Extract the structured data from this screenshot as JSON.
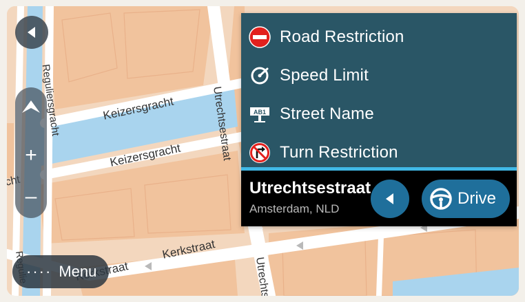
{
  "map": {
    "street_labels": {
      "keizersgracht_top": "Keizersgracht",
      "keizersgracht_bottom": "Keizersgracht",
      "utrechtsestraat_top": "Utrechtsestraat",
      "utrechtsestraat_bottom": "Utrechts",
      "reguliersgracht_top": "Reguliersgracht",
      "reguliersgracht_bottom": "Regulie",
      "kerkstraat_right": "Kerkstraat",
      "kerkstraat_left": "Kerkstraat",
      "partial_left": "cht"
    }
  },
  "context_menu": {
    "items": [
      {
        "label": "Road Restriction",
        "icon": "no-entry-icon"
      },
      {
        "label": "Speed Limit",
        "icon": "speedometer-icon"
      },
      {
        "label": "Street Name",
        "icon": "street-sign-icon"
      },
      {
        "label": "Turn Restriction",
        "icon": "no-right-turn-icon"
      }
    ]
  },
  "location": {
    "street": "Utrechtsestraat",
    "city": "Amsterdam, NLD"
  },
  "actions": {
    "drive_label": "Drive"
  },
  "controls": {
    "zoom_in": "+",
    "zoom_out": "–",
    "menu_dots": "····",
    "menu_label": "Menu"
  },
  "colors": {
    "panel_bg": "#2a5666",
    "accent": "#40b8e6",
    "button_bg": "#1f6f9b",
    "road_restriction_red": "#e2201d",
    "water": "#a9d4ee",
    "building": "#f1c39d"
  }
}
